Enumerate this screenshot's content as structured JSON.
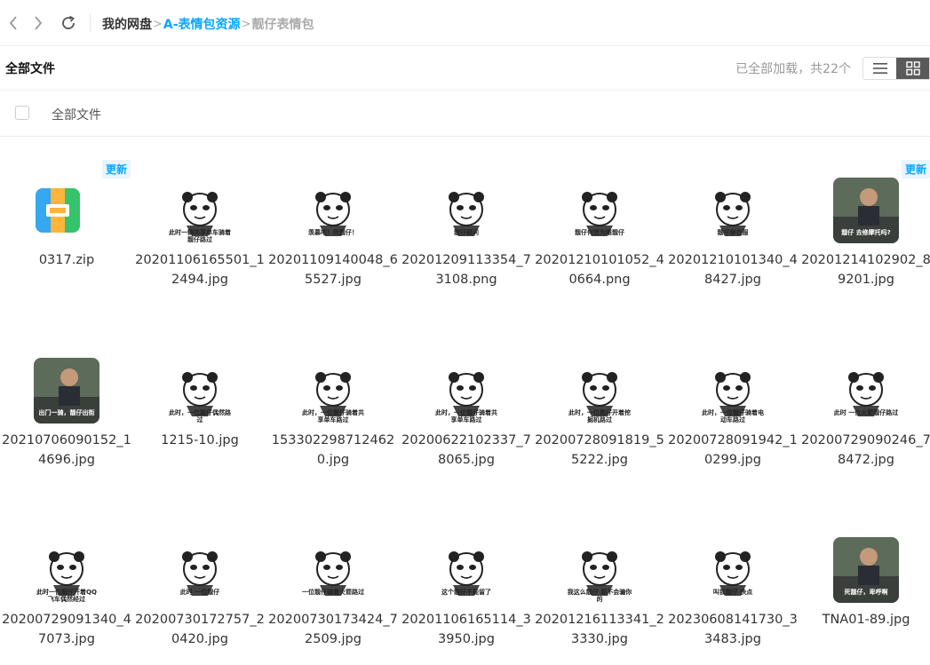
{
  "nav": {
    "back_icon": "chevron-left-icon",
    "forward_icon": "chevron-right-icon",
    "refresh_icon": "refresh-icon"
  },
  "breadcrumb": {
    "root": "我的网盘",
    "parent": "A-表情包资源",
    "current": "靓仔表情包",
    "separator": ">"
  },
  "toolbar": {
    "title": "全部文件",
    "status": "已全部加载，共22个",
    "list_view_icon": "list-icon",
    "grid_view_icon": "grid-icon"
  },
  "selection": {
    "label": "全部文件"
  },
  "colors": {
    "accent": "#06a7ff",
    "badge_bg": "#eaf4ff",
    "active_view": "#5a5a5a"
  },
  "files": [
    {
      "name": "0317.zip",
      "badge": "更新",
      "kind": "zip"
    },
    {
      "name": "20201106165501_12494.jpg",
      "badge": "",
      "caption": "此时一辆共享单车骑着靓仔路过",
      "kind": "sketch"
    },
    {
      "name": "20201109140048_65527.jpg",
      "badge": "",
      "caption": "羡慕吧！死靓仔！",
      "kind": "sketch"
    },
    {
      "name": "20201209113354_73108.png",
      "badge": "",
      "caption": "靓仔疑问",
      "kind": "sketch"
    },
    {
      "name": "20201210101052_40664.png",
      "badge": "",
      "caption": "靓仔何苦为难靓仔",
      "kind": "sketch"
    },
    {
      "name": "20201210101340_48427.jpg",
      "badge": "",
      "caption": "靓仔穿衣服",
      "kind": "sketch"
    },
    {
      "name": "20201214102902_89201.jpg",
      "badge": "更新",
      "caption": "靓仔 去修摩托吗?",
      "kind": "photo"
    },
    {
      "name": "20210706090152_14696.jpg",
      "badge": "",
      "caption": "出门一骑，靓仔出街",
      "kind": "photo"
    },
    {
      "name": "1215-10.jpg",
      "badge": "",
      "caption": "此时，一位靓仔偶然路过",
      "kind": "sketch"
    },
    {
      "name": "1533022987124620.jpg",
      "badge": "",
      "caption": "此时，一位靓仔骑着共享单车路过",
      "kind": "sketch"
    },
    {
      "name": "20200622102337_78065.jpg",
      "badge": "",
      "caption": "此时，一位靓仔骑着共享单车路过",
      "kind": "sketch"
    },
    {
      "name": "20200728091819_55222.jpg",
      "badge": "",
      "caption": "此时，一位靓仔开着挖掘机路过",
      "kind": "sketch"
    },
    {
      "name": "20200728091942_10299.jpg",
      "badge": "",
      "caption": "此时，一位靓仔骑着电动车路过",
      "kind": "sketch"
    },
    {
      "name": "20200729090246_78472.jpg",
      "badge": "",
      "caption": "此时 一位火箭靓仔路过",
      "kind": "sketch"
    },
    {
      "name": "20200729091340_47073.jpg",
      "badge": "",
      "caption": "此时一位靓仔开着QQ飞车偶然经过",
      "kind": "sketch"
    },
    {
      "name": "20200730172757_20420.jpg",
      "badge": "",
      "caption": "此时 一位靓仔",
      "kind": "sketch"
    },
    {
      "name": "20200730173424_72509.jpg",
      "badge": "",
      "caption": "一位靓仔骑着火箭路过",
      "kind": "sketch"
    },
    {
      "name": "20201106165114_33950.jpg",
      "badge": "",
      "caption": "这个靓仔不能留了",
      "kind": "sketch"
    },
    {
      "name": "20201216113341_23330.jpg",
      "badge": "",
      "caption": "我这么靓仔 是不会骗你的",
      "kind": "sketch"
    },
    {
      "name": "20230608141730_33483.jpg",
      "badge": "",
      "caption": "叫我靓仔 快点",
      "kind": "sketch"
    },
    {
      "name": "TNA01-89.jpg",
      "badge": "",
      "caption": "死靓仔，卑呼啊",
      "kind": "photo"
    }
  ]
}
